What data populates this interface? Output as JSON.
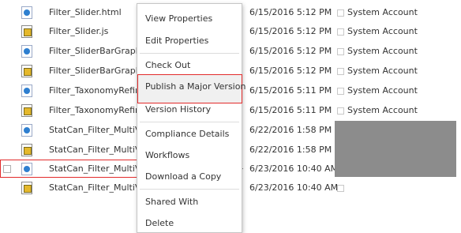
{
  "files": [
    {
      "name": "Filter_Slider.html",
      "type": "html",
      "modified": "6/15/2016 5:12 PM",
      "author": "System Account"
    },
    {
      "name": "Filter_Slider.js",
      "type": "js",
      "modified": "6/15/2016 5:12 PM",
      "author": "System Account"
    },
    {
      "name": "Filter_SliderBarGraph.htm",
      "type": "html",
      "modified": "6/15/2016 5:12 PM",
      "author": "System Account"
    },
    {
      "name": "Filter_SliderBarGraph.js",
      "type": "js",
      "modified": "6/15/2016 5:12 PM",
      "author": "System Account"
    },
    {
      "name": "Filter_TaxonomyRefinem",
      "type": "html",
      "modified": "6/15/2016 5:11 PM",
      "author": "System Account"
    },
    {
      "name": "Filter_TaxonomyRefinem",
      "type": "js",
      "modified": "6/15/2016 5:11 PM",
      "author": "System Account"
    },
    {
      "name": "StatCan_Filter_MultiValu",
      "type": "html",
      "modified": "6/22/2016 1:58 PM",
      "author": ""
    },
    {
      "name": "StatCan_Filter_MultiValu",
      "type": "js",
      "modified": "6/22/2016 1:58 PM",
      "author": ""
    },
    {
      "name": "StatCan_Filter_MultiValu",
      "type": "html",
      "modified": "6/23/2016 10:40 AM",
      "author": ""
    },
    {
      "name": "StatCan_Filter_MultiValu",
      "type": "js",
      "modified": "6/23/2016 10:40 AM",
      "author": ""
    }
  ],
  "context_menu": {
    "view_properties": "View Properties",
    "edit_properties": "Edit Properties",
    "check_out": "Check Out",
    "publish_major_version": "Publish a Major Version",
    "version_history": "Version History",
    "compliance_details": "Compliance Details",
    "workflows": "Workflows",
    "download_copy": "Download a Copy",
    "shared_with": "Shared With",
    "delete": "Delete"
  },
  "colors": {
    "highlight_outline": "#e22b2b",
    "redaction_block": "#8c8c8c"
  }
}
